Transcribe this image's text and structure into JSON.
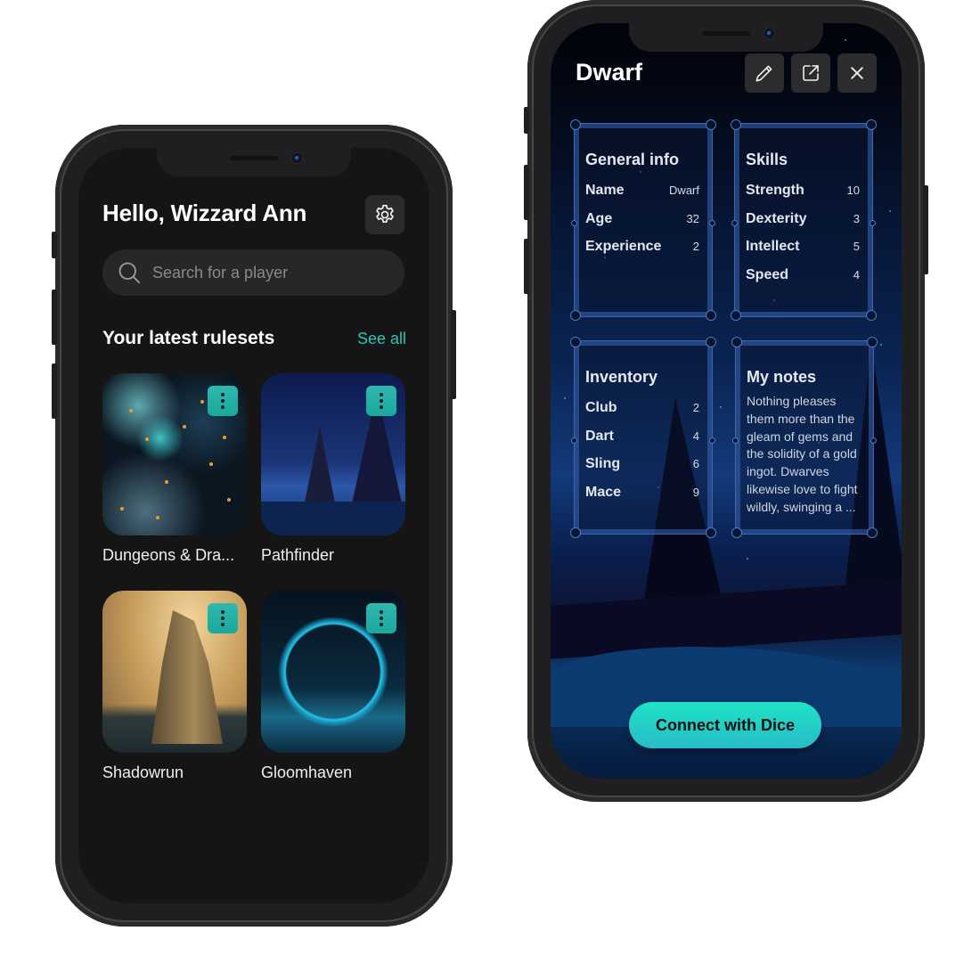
{
  "home_screen": {
    "greeting": "Hello, Wizzard Ann",
    "settings_icon": "gear-icon",
    "search": {
      "icon": "search-icon",
      "placeholder": "Search for a player",
      "value": ""
    },
    "rulesets_section": {
      "title": "Your latest rulesets",
      "see_all_label": "See all",
      "accent_color": "#2ec4b6",
      "items": [
        {
          "title": "Dungeons & Dra...",
          "menu_icon": "kebab-menu-icon"
        },
        {
          "title": "Pathfinder",
          "menu_icon": "kebab-menu-icon"
        },
        {
          "title": "Shadowrun",
          "menu_icon": "kebab-menu-icon"
        },
        {
          "title": "Gloomhaven",
          "menu_icon": "kebab-menu-icon"
        }
      ]
    }
  },
  "character_screen": {
    "title": "Dwarf",
    "actions": [
      {
        "name": "edit",
        "icon": "pencil-icon"
      },
      {
        "name": "open-external",
        "icon": "external-link-icon"
      },
      {
        "name": "close",
        "icon": "close-icon"
      }
    ],
    "general_info": {
      "title": "General info",
      "rows": [
        {
          "label": "Name",
          "value": "Dwarf"
        },
        {
          "label": "Age",
          "value": "32"
        },
        {
          "label": "Experience",
          "value": "2"
        }
      ]
    },
    "skills": {
      "title": "Skills",
      "rows": [
        {
          "label": "Strength",
          "value": "10"
        },
        {
          "label": "Dexterity",
          "value": "3"
        },
        {
          "label": "Intellect",
          "value": "5"
        },
        {
          "label": "Speed",
          "value": "4"
        }
      ]
    },
    "inventory": {
      "title": "Inventory",
      "rows": [
        {
          "label": "Club",
          "value": "2"
        },
        {
          "label": "Dart",
          "value": "4"
        },
        {
          "label": "Sling",
          "value": "6"
        },
        {
          "label": "Mace",
          "value": "9"
        }
      ]
    },
    "notes": {
      "title": "My notes",
      "text": "Nothing pleases them more than the gleam of gems and the solidity of a gold ingot. Dwarves likewise love to fight wildly, swinging a ..."
    },
    "cta_label": "Connect with Dice",
    "cta_color": "#1fe3c6"
  }
}
